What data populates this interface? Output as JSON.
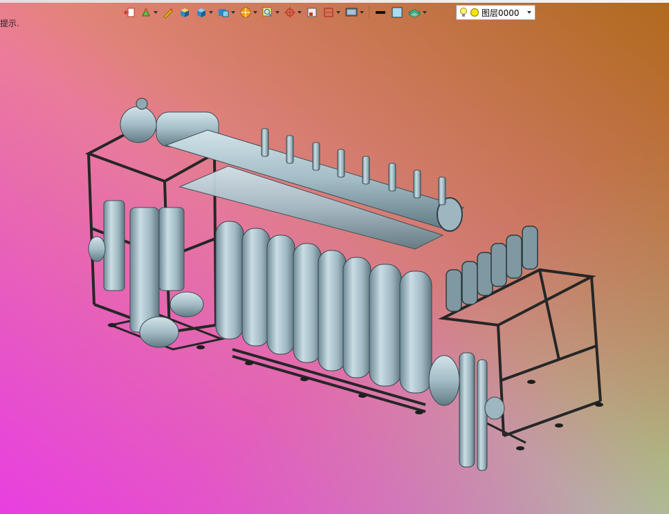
{
  "hint": {
    "text": "提示."
  },
  "toolbar": {
    "icons": [
      "exit-icon",
      "paint-icon",
      "pencil-icon",
      "box-icon",
      "cube-icon",
      "section-view-icon",
      "render-icon",
      "zoom-icon",
      "axis-icon",
      "frame-icon",
      "crop-icon",
      "display-icon",
      "line-weight-icon",
      "color-swatch-icon",
      "layer-stack-icon"
    ],
    "colors": {
      "swatch": "#a9dcef",
      "line": "#111111"
    }
  },
  "layer": {
    "name": "图层0000",
    "lamp": "bulb-icon",
    "state": "yellow-dot-icon"
  },
  "viewport": {
    "model": "pipe-skid-assembly",
    "model_color": "#a8c4cf",
    "frame_color": "#2a2a2a"
  }
}
